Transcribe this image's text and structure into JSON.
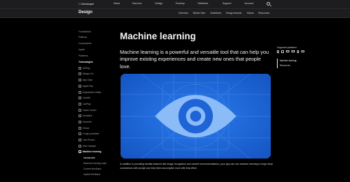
{
  "globalnav": {
    "logo": " Developer",
    "items": [
      "News",
      "Discover",
      "Design",
      "Develop",
      "Distribute",
      "Support",
      "Account"
    ],
    "search_icon": "search-icon"
  },
  "subnav": {
    "title": "Design",
    "items": [
      "Overview",
      "What's New",
      "Guidelines",
      "Design Awards",
      "Videos",
      "Resources"
    ]
  },
  "sidebar": {
    "top_items": [
      "Foundations",
      "Patterns",
      "Components",
      "Inputs",
      "Platforms"
    ],
    "technologies_heading": "Technologies",
    "technologies": [
      "AirPlay",
      "Always On",
      "App Clips",
      "Apple Pay",
      "Augmented reality",
      "CareKit",
      "CarPlay",
      "Game Center",
      "HealthKit",
      "HomeKit",
      "iCloud",
      "In-app purchase",
      "Live Photos",
      "Mac Catalyst",
      "Machine learning"
    ],
    "active_item": "Machine learning",
    "sub_items": [
      "Introduction",
      "Machine learning index",
      "Content feedback",
      "Implicit feedback"
    ]
  },
  "main": {
    "title": "Machine learning",
    "lede": "Machine learning is a powerful and versatile tool that can help you improve existing experiences and create new ones that people love.",
    "hero_icon": "eye-icon",
    "body": "In addition to providing familiar features like image recognition and content recommendations, your app can use machine learning to forge deep connections with people and help them accomplish more with less effort."
  },
  "rail": {
    "supported_title": "Supported platforms",
    "platform_icons": [
      "iphone-icon",
      "ipad-icon",
      "mac-icon",
      "tv-icon",
      "watch-icon",
      "vision-icon"
    ],
    "links": [
      "Machine learning",
      "Resources"
    ]
  },
  "colors": {
    "background": "#000000",
    "hero_blue": "#1f6ee0",
    "eye_light": "#7fb2f5"
  }
}
